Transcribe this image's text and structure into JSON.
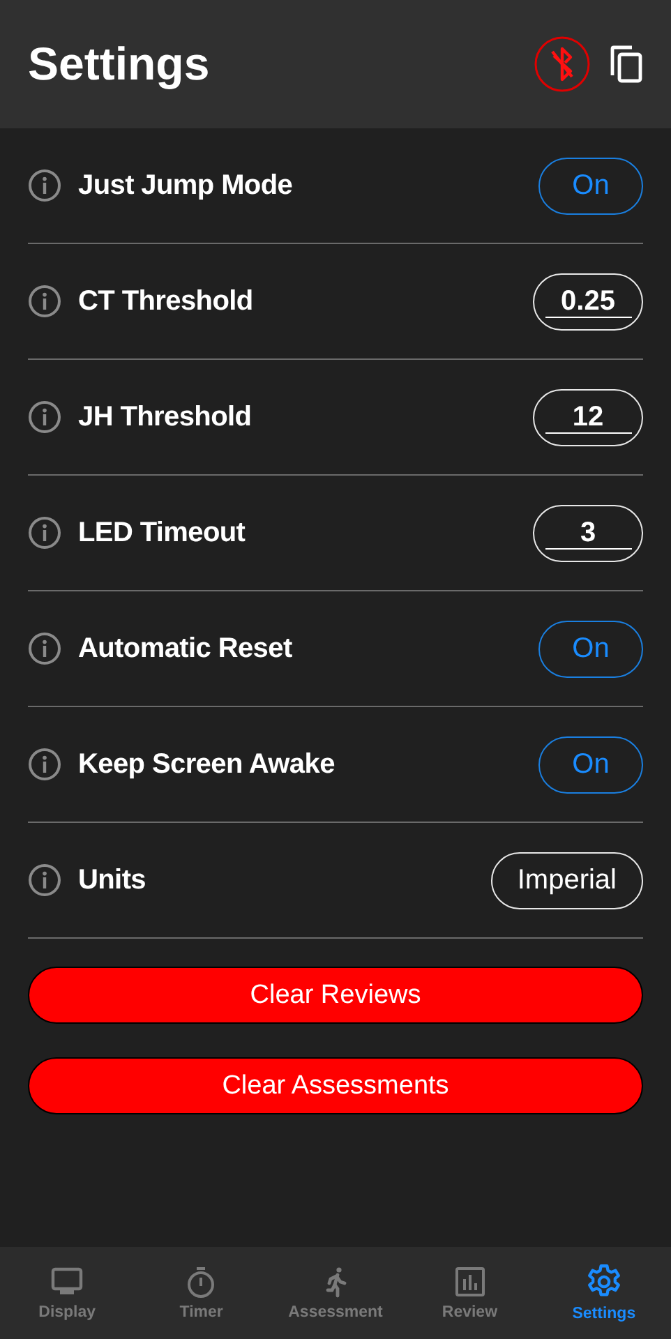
{
  "header": {
    "title": "Settings"
  },
  "settings": [
    {
      "label": "Just Jump Mode",
      "kind": "toggle",
      "value": "On"
    },
    {
      "label": "CT Threshold",
      "kind": "input",
      "value": "0.25"
    },
    {
      "label": "JH Threshold",
      "kind": "input",
      "value": "12"
    },
    {
      "label": "LED Timeout",
      "kind": "input",
      "value": "3"
    },
    {
      "label": "Automatic Reset",
      "kind": "toggle",
      "value": "On"
    },
    {
      "label": "Keep Screen Awake",
      "kind": "toggle",
      "value": "On"
    },
    {
      "label": "Units",
      "kind": "select",
      "value": "Imperial"
    }
  ],
  "actions": [
    "Clear Reviews",
    "Clear Assessments"
  ],
  "tabs": [
    {
      "label": "Display",
      "selected": false
    },
    {
      "label": "Timer",
      "selected": false
    },
    {
      "label": "Assessment",
      "selected": false
    },
    {
      "label": "Review",
      "selected": false
    },
    {
      "label": "Settings",
      "selected": true
    }
  ]
}
